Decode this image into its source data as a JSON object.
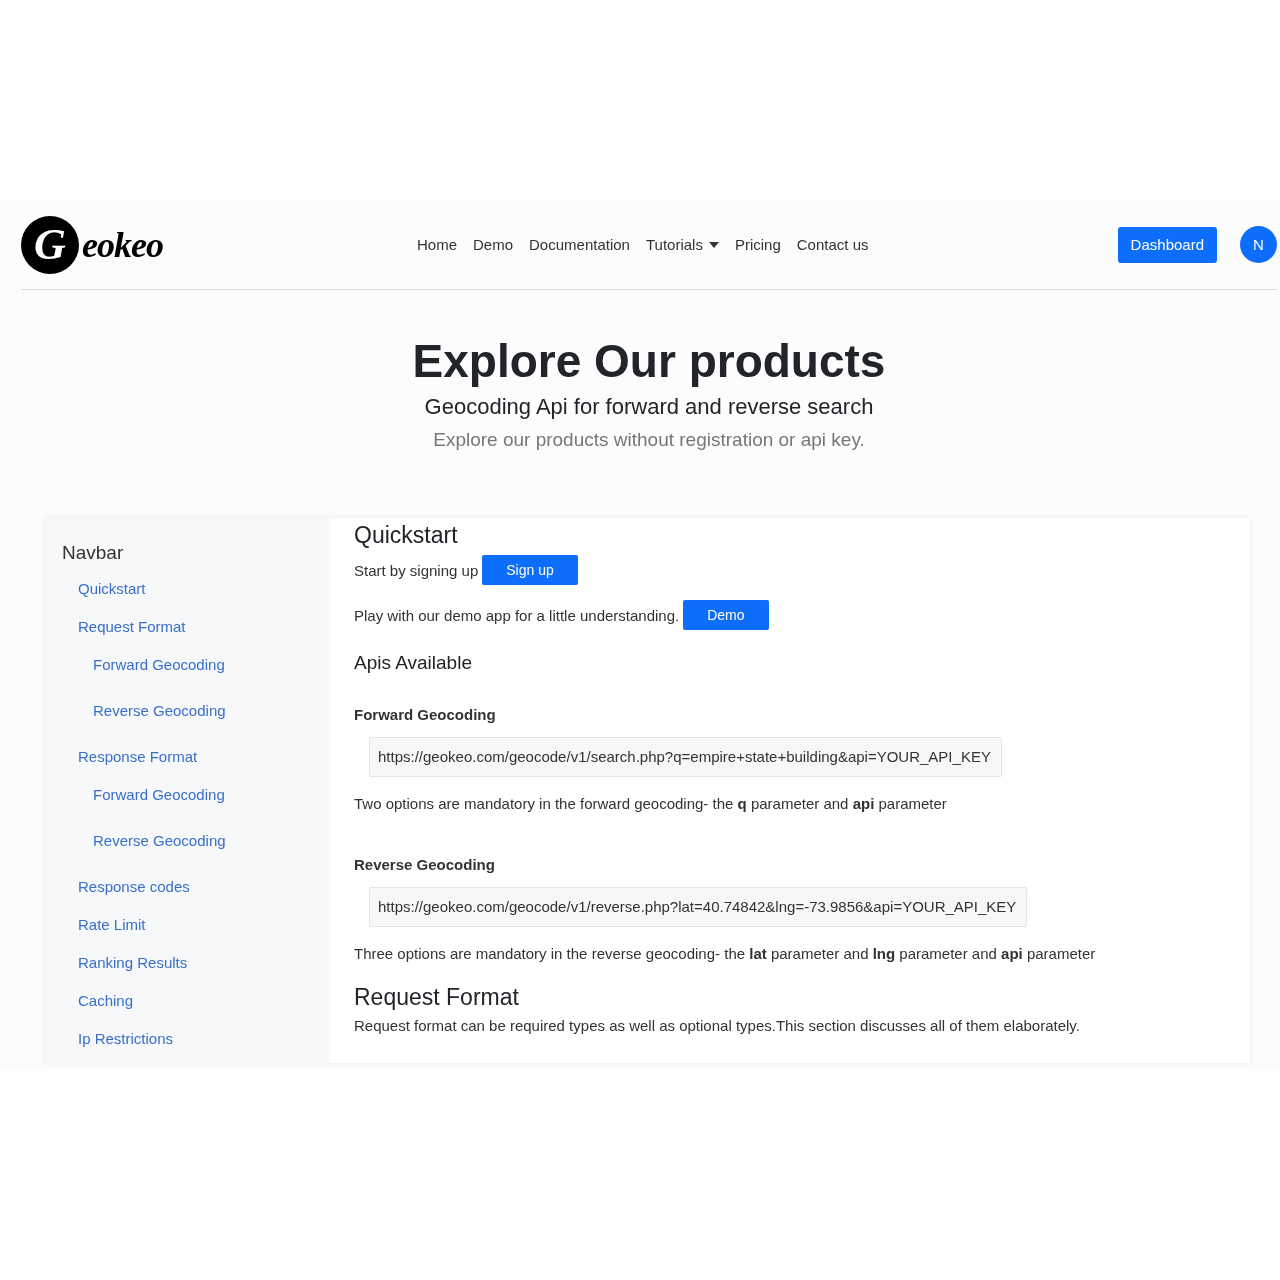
{
  "header": {
    "logo": {
      "initial": "G",
      "wordmark": "eokeo"
    },
    "nav": [
      {
        "label": "Home",
        "kind": "link"
      },
      {
        "label": "Demo",
        "kind": "link"
      },
      {
        "label": "Documentation",
        "kind": "link"
      },
      {
        "label": "Tutorials",
        "kind": "dropdown"
      },
      {
        "label": "Pricing",
        "kind": "link"
      },
      {
        "label": "Contact us",
        "kind": "link"
      }
    ],
    "dashboard_button": "Dashboard",
    "avatar": "N"
  },
  "hero": {
    "title": "Explore Our products",
    "subtitle": "Geocoding Api for forward and reverse search",
    "lead": "Explore our products without registration or api key."
  },
  "sidebar": {
    "title": "Navbar",
    "items": [
      {
        "label": "Quickstart"
      },
      {
        "label": "Request Format",
        "children": [
          {
            "label": "Forward Geocoding"
          },
          {
            "label": "Reverse Geocoding"
          }
        ]
      },
      {
        "label": "Response Format",
        "children": [
          {
            "label": "Forward Geocoding"
          },
          {
            "label": "Reverse Geocoding"
          }
        ]
      },
      {
        "label": "Response codes"
      },
      {
        "label": "Rate Limit"
      },
      {
        "label": "Ranking Results"
      },
      {
        "label": "Caching"
      },
      {
        "label": "Ip Restrictions"
      }
    ]
  },
  "content": [
    {
      "kind": "h2",
      "text": "Quickstart"
    },
    {
      "kind": "text_button",
      "text": "Start by signing up",
      "button": "Sign up"
    },
    {
      "kind": "text_button",
      "text": "Play with our demo app for a little understanding.",
      "button": "Demo"
    },
    {
      "kind": "h3",
      "text": "Apis Available"
    },
    {
      "kind": "h5",
      "text": "Forward Geocoding"
    },
    {
      "kind": "code",
      "text": "https://geokeo.com/geocode/v1/search.php?q=empire+state+building&api=YOUR_API_KEY"
    },
    {
      "kind": "p",
      "text": "Two options are mandatory in the forward geocoding- the **q** parameter and **api** parameter"
    },
    {
      "kind": "h5",
      "text": "Reverse Geocoding"
    },
    {
      "kind": "code",
      "text": "https://geokeo.com/geocode/v1/reverse.php?lat=40.74842&lng=-73.9856&api=YOUR_API_KEY"
    },
    {
      "kind": "p",
      "text": "Three options are mandatory in the reverse geocoding- the **lat** parameter and **lng** parameter and **api** parameter"
    },
    {
      "kind": "h2",
      "text": "Request Format"
    },
    {
      "kind": "p",
      "text": "Request format can be required types as well as optional types.This section discusses all of them elaborately."
    }
  ]
}
